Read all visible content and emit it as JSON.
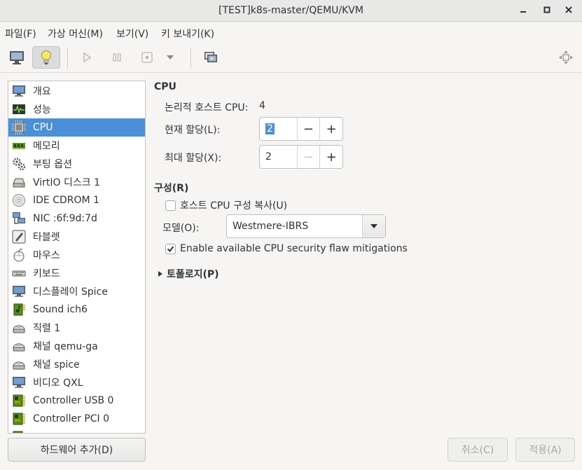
{
  "window": {
    "title": "[TEST]k8s-master/QEMU/KVM"
  },
  "menu": {
    "file": "파일(F)",
    "vm": "가상 머신(M)",
    "view": "보기(V)",
    "sendkey": "키 보내기(K)"
  },
  "sidebar": {
    "items": [
      {
        "label": "개요",
        "icon": "monitor-icon"
      },
      {
        "label": "성능",
        "icon": "performance-graph-icon"
      },
      {
        "label": "CPU",
        "icon": "cpu-chip-icon"
      },
      {
        "label": "메모리",
        "icon": "memory-module-icon"
      },
      {
        "label": "부팅 옵션",
        "icon": "gears-icon"
      },
      {
        "label": "VirtIO 디스크 1",
        "icon": "hard-disk-icon"
      },
      {
        "label": "IDE CDROM 1",
        "icon": "cdrom-icon"
      },
      {
        "label": "NIC :6f:9d:7d",
        "icon": "network-icon"
      },
      {
        "label": "타블렛",
        "icon": "tablet-icon"
      },
      {
        "label": "마우스",
        "icon": "mouse-icon"
      },
      {
        "label": "키보드",
        "icon": "keyboard-icon"
      },
      {
        "label": "디스플레이 Spice",
        "icon": "display-icon"
      },
      {
        "label": "Sound ich6",
        "icon": "sound-card-icon"
      },
      {
        "label": "직렬 1",
        "icon": "serial-icon"
      },
      {
        "label": "채널 qemu-ga",
        "icon": "channel-icon"
      },
      {
        "label": "채널 spice",
        "icon": "channel-icon"
      },
      {
        "label": "비디오 QXL",
        "icon": "video-icon"
      },
      {
        "label": "Controller USB 0",
        "icon": "controller-icon"
      },
      {
        "label": "Controller PCI 0",
        "icon": "controller-icon"
      }
    ],
    "selected_index": 2
  },
  "add_hardware_label": "하드웨어 추가(D)",
  "cpu": {
    "section_title": "CPU",
    "logical_host_label": "논리적 호스트 CPU:",
    "logical_host_value": "4",
    "current_label": "현재 할당(L):",
    "current_value": "2",
    "max_label": "최대 할당(X):",
    "max_value": "2",
    "minus": "−",
    "plus": "+"
  },
  "config": {
    "section_title": "구성(R)",
    "copy_host_label": "호스트 CPU 구성 복사(U)",
    "copy_host_checked": false,
    "model_label": "모델(O):",
    "model_value": "Westmere-IBRS",
    "mitigation_label": "Enable available CPU security flaw mitigations",
    "mitigation_checked": true
  },
  "topology": {
    "label": "토폴로지(P)"
  },
  "footer": {
    "cancel_label": "취소(C)",
    "apply_label": "적용(A)"
  },
  "colors": {
    "selection": "#4a90d9",
    "background": "#f6f5f4"
  }
}
